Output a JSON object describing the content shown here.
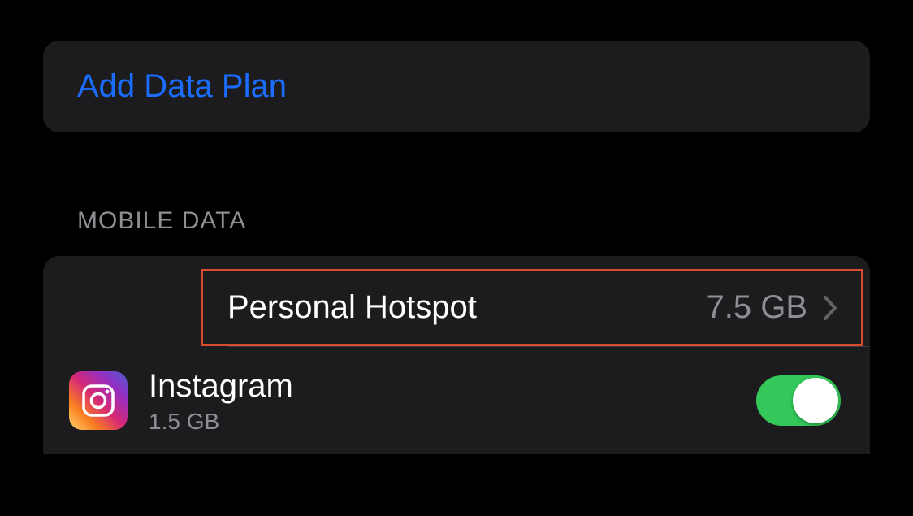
{
  "add_plan": {
    "label": "Add Data Plan"
  },
  "section": {
    "header": "MOBILE DATA"
  },
  "hotspot": {
    "label": "Personal Hotspot",
    "value": "7.5 GB"
  },
  "app": {
    "name": "Instagram",
    "usage": "1.5 GB",
    "toggle_on": true
  }
}
